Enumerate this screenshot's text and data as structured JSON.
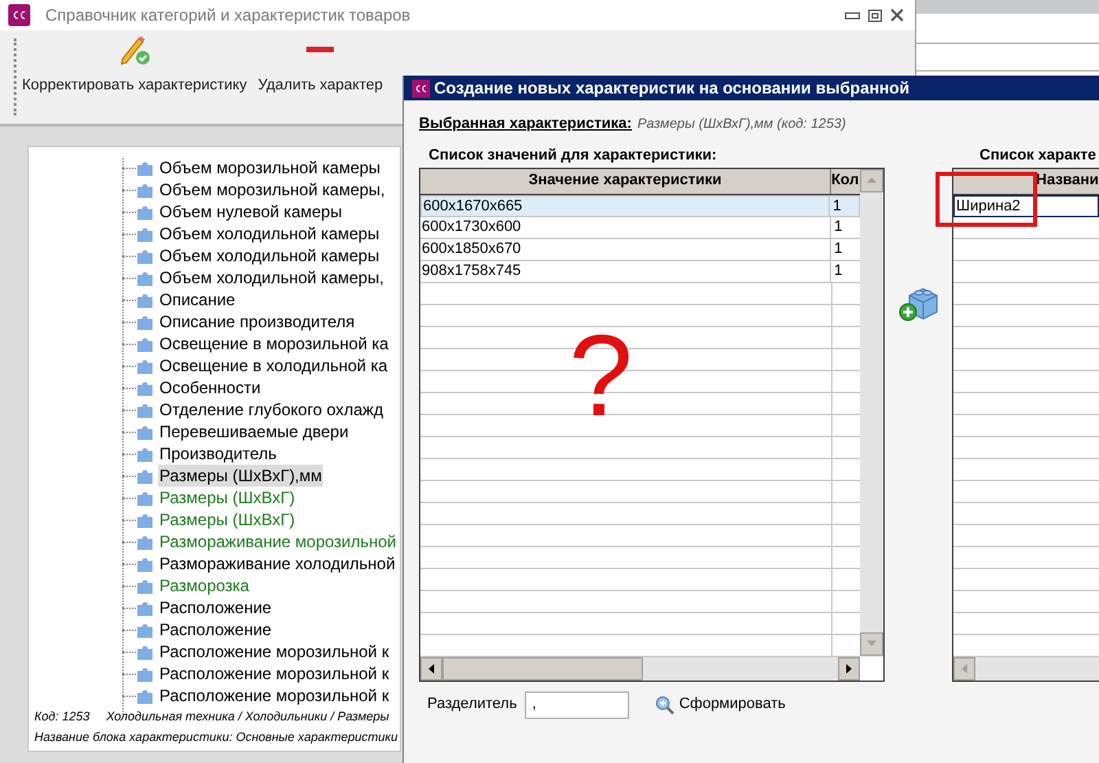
{
  "main_window": {
    "title": "Справочник категорий и характеристик товаров"
  },
  "toolbar": [
    {
      "label": "Корректировать характеристику",
      "kind": "edit"
    },
    {
      "label": "Удалить характер",
      "kind": "delete"
    }
  ],
  "tree": {
    "items": [
      {
        "label": "Объем морозильной камеры",
        "color": "#000000",
        "selected": false
      },
      {
        "label": "Объем морозильной камеры,",
        "color": "#000000",
        "selected": false
      },
      {
        "label": "Объем нулевой камеры",
        "color": "#000000",
        "selected": false
      },
      {
        "label": "Объем холодильной камеры",
        "color": "#000000",
        "selected": false
      },
      {
        "label": "Объем холодильной камеры",
        "color": "#000000",
        "selected": false
      },
      {
        "label": "Объем холодильной камеры,",
        "color": "#000000",
        "selected": false
      },
      {
        "label": "Описание",
        "color": "#000000",
        "selected": false
      },
      {
        "label": "Описание производителя",
        "color": "#000000",
        "selected": false
      },
      {
        "label": "Освещение в морозильной ка",
        "color": "#000000",
        "selected": false
      },
      {
        "label": "Освещение в холодильной ка",
        "color": "#000000",
        "selected": false
      },
      {
        "label": "Особенности",
        "color": "#000000",
        "selected": false
      },
      {
        "label": "Отделение глубокого охлажд",
        "color": "#000000",
        "selected": false
      },
      {
        "label": "Перевешиваемые двери",
        "color": "#000000",
        "selected": false
      },
      {
        "label": "Производитель",
        "color": "#000000",
        "selected": false
      },
      {
        "label": "Размеры (ШхВхГ),мм",
        "color": "#000000",
        "selected": true
      },
      {
        "label": "Размеры (ШхВхГ)",
        "color": "#1e7b1e",
        "selected": false
      },
      {
        "label": "Размеры (ШхВхГ)",
        "color": "#1e7b1e",
        "selected": false
      },
      {
        "label": "Размораживание морозильной",
        "color": "#1e7b1e",
        "selected": false
      },
      {
        "label": "Размораживание холодильной",
        "color": "#000000",
        "selected": false
      },
      {
        "label": "Разморозка",
        "color": "#1e7b1e",
        "selected": false
      },
      {
        "label": "Расположение",
        "color": "#000000",
        "selected": false
      },
      {
        "label": "Расположение",
        "color": "#000000",
        "selected": false
      },
      {
        "label": "Расположение морозильной к",
        "color": "#000000",
        "selected": false
      },
      {
        "label": "Расположение морозильной к",
        "color": "#000000",
        "selected": false
      },
      {
        "label": "Расположение морозильной к",
        "color": "#000000",
        "selected": false
      }
    ]
  },
  "footer": {
    "code": "Код: 1253",
    "path": "Холодильная техника / Холодильники / Размеры",
    "block": "Название блока характеристики: Основные характеристики"
  },
  "dialog": {
    "title": "Создание новых характеристик на основании выбранной",
    "selected_label": "Выбранная характеристика:",
    "selected_value": "Размеры (ШхВхГ),мм (код: 1253)",
    "values_heading": "Список значений для характеристики:",
    "values_table": {
      "columns": [
        "Значение характеристики",
        "Кол"
      ],
      "rows": [
        {
          "cells": [
            "600x1670x665",
            "1"
          ],
          "selected": true
        },
        {
          "cells": [
            "600x1730x600",
            "1"
          ],
          "selected": false
        },
        {
          "cells": [
            "600x1850x670",
            "1"
          ],
          "selected": false
        },
        {
          "cells": [
            "908x1758x745",
            "1"
          ],
          "selected": false
        }
      ]
    },
    "overlay_mark": "?",
    "new_heading": "Список характе",
    "new_table": {
      "columns": [
        "Названи"
      ],
      "rows": [
        {
          "cells": [
            "Ширина2"
          ]
        }
      ]
    },
    "separator": {
      "label": "Разделитель",
      "value": ","
    },
    "generate_button": "Сформировать"
  }
}
